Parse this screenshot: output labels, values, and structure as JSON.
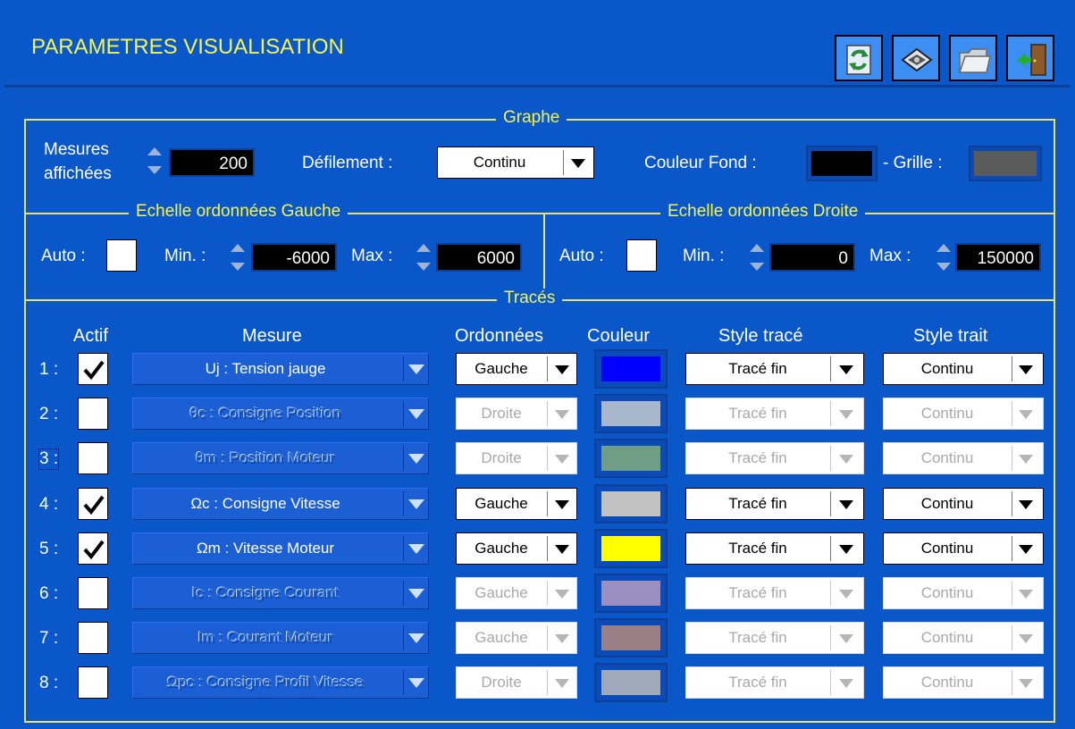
{
  "header": {
    "title": "PARAMETRES VISUALISATION",
    "buttons": [
      {
        "name": "refresh-icon"
      },
      {
        "name": "save-disk-icon"
      },
      {
        "name": "open-folder-icon"
      },
      {
        "name": "exit-door-icon"
      }
    ]
  },
  "graphe": {
    "title": "Graphe",
    "mesures_label_1": "Mesures",
    "mesures_label_2": "affichées",
    "mesures_value": "200",
    "defilement_label": "Défilement :",
    "defilement_value": "Continu",
    "couleur_fond_label": "Couleur Fond :",
    "couleur_fond": "#000000",
    "grille_label": "- Grille :",
    "grille_color": "#5b5b5b"
  },
  "gauche": {
    "title": "Echelle ordonnées Gauche",
    "auto_label": "Auto :",
    "auto_checked": false,
    "min_label": "Min. :",
    "min_value": "-6000",
    "max_label": "Max :",
    "max_value": "6000"
  },
  "droite": {
    "title": "Echelle ordonnées Droite",
    "auto_label": "Auto :",
    "auto_checked": false,
    "min_label": "Min. :",
    "min_value": "0",
    "max_label": "Max :",
    "max_value": "150000"
  },
  "traces": {
    "title": "Tracés",
    "headers": {
      "actif": "Actif",
      "mesure": "Mesure",
      "ordonnees": "Ordonnées",
      "couleur": "Couleur",
      "style_trace": "Style tracé",
      "style_trait": "Style trait"
    },
    "rows": [
      {
        "num": "1 :",
        "active": true,
        "mesure": "Uj : Tension jauge",
        "ordonnees": "Gauche",
        "color": "#0000ff",
        "style_trace": "Tracé fin",
        "style_trait": "Continu"
      },
      {
        "num": "2 :",
        "active": false,
        "mesure": "θc : Consigne Position",
        "ordonnees": "Droite",
        "color": "#a9b7cc",
        "style_trace": "Tracé fin",
        "style_trait": "Continu"
      },
      {
        "num": "3 :",
        "active": false,
        "mesure": "θm : Position Moteur",
        "ordonnees": "Droite",
        "color": "#6f9e86",
        "style_trace": "Tracé fin",
        "style_trait": "Continu"
      },
      {
        "num": "4 :",
        "active": true,
        "mesure": "Ωc : Consigne Vitesse",
        "ordonnees": "Gauche",
        "color": "#c2c2c2",
        "style_trace": "Tracé fin",
        "style_trait": "Continu"
      },
      {
        "num": "5 :",
        "active": true,
        "mesure": "Ωm : Vitesse Moteur",
        "ordonnees": "Gauche",
        "color": "#ffff00",
        "style_trace": "Tracé fin",
        "style_trait": "Continu"
      },
      {
        "num": "6 :",
        "active": false,
        "mesure": "Ic : Consigne Courant",
        "ordonnees": "Gauche",
        "color": "#9b8ec0",
        "style_trace": "Tracé fin",
        "style_trait": "Continu"
      },
      {
        "num": "7 :",
        "active": false,
        "mesure": "Im : Courant Moteur",
        "ordonnees": "Gauche",
        "color": "#9a7f86",
        "style_trace": "Tracé fin",
        "style_trait": "Continu"
      },
      {
        "num": "8 :",
        "active": false,
        "mesure": "Ωpc : Consigne Profil Vitesse",
        "ordonnees": "Droite",
        "color": "#9eaab9",
        "style_trace": "Tracé fin",
        "style_trait": "Continu"
      }
    ]
  }
}
